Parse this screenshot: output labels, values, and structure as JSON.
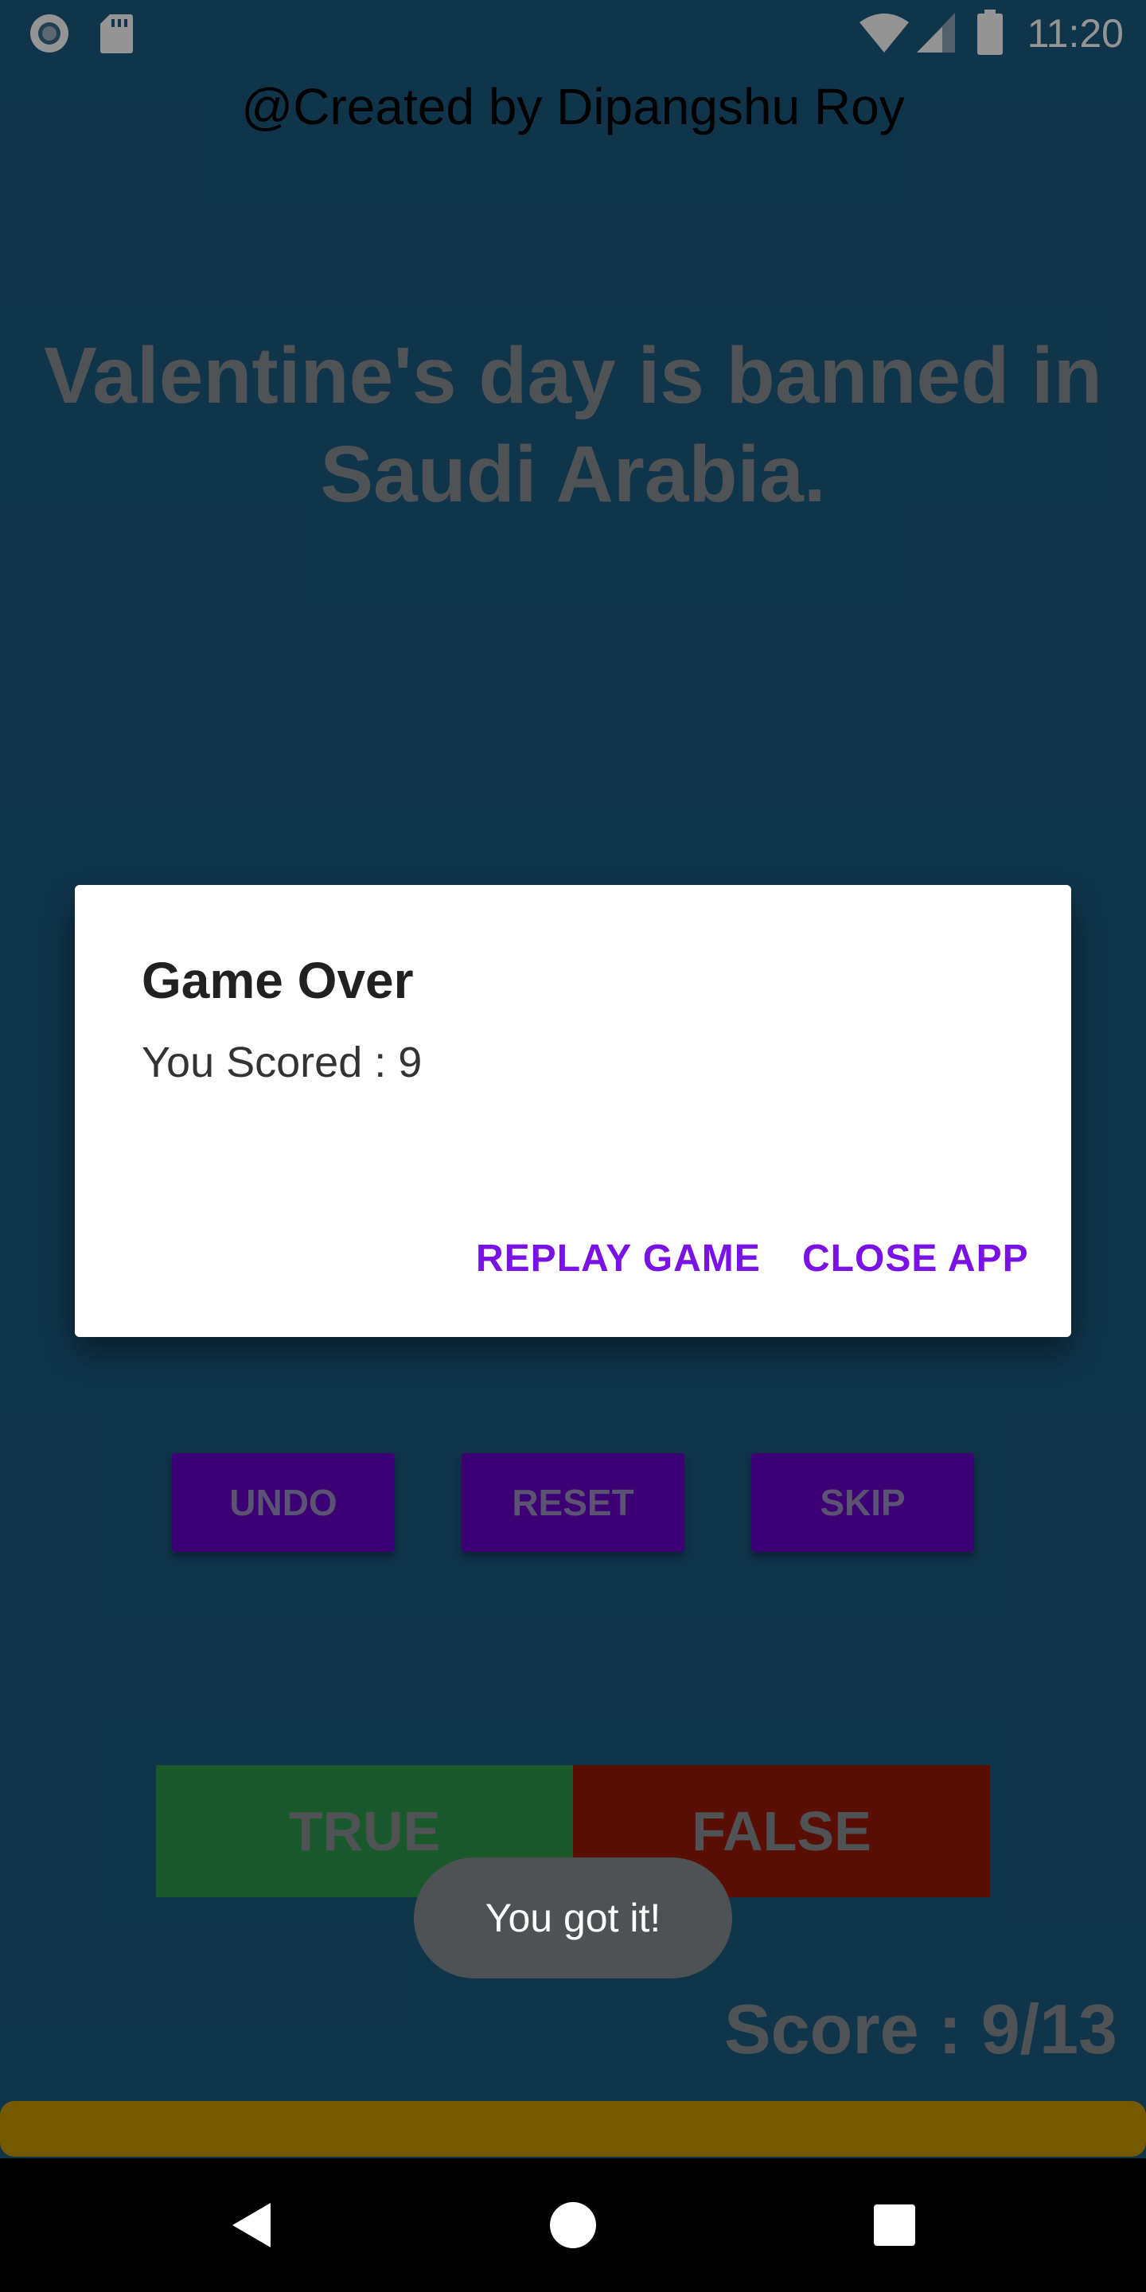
{
  "status_bar": {
    "time": "11:20",
    "left_icons": [
      "record-icon",
      "sd-card-icon"
    ],
    "right_icons": [
      "wifi-icon",
      "cell-signal-icon",
      "battery-icon"
    ]
  },
  "header": {
    "credit": "@Created by Dipangshu Roy"
  },
  "question": {
    "text": "Valentine's day is banned in Saudi Arabia."
  },
  "controls": {
    "undo_label": "UNDO",
    "reset_label": "RESET",
    "skip_label": "SKIP"
  },
  "answers": {
    "true_label": "TRUE",
    "false_label": "FALSE"
  },
  "score": {
    "text": "Score : 9/13",
    "value": 9,
    "total": 13
  },
  "progress": {
    "fraction": 1.0
  },
  "dialog": {
    "title": "Game Over",
    "message": "You Scored : 9",
    "replay_label": "REPLAY GAME",
    "close_label": "CLOSE APP"
  },
  "toast": {
    "text": "You got it!"
  },
  "nav": {
    "icons": [
      "back-icon",
      "home-icon",
      "recents-icon"
    ]
  },
  "colors": {
    "background": "#1d5a80",
    "control_button": "#6a00c8",
    "true_button": "#2e9a4a",
    "false_button": "#9a1a0a",
    "progress": "#c89a00",
    "dialog_accent": "#7a12e6"
  }
}
